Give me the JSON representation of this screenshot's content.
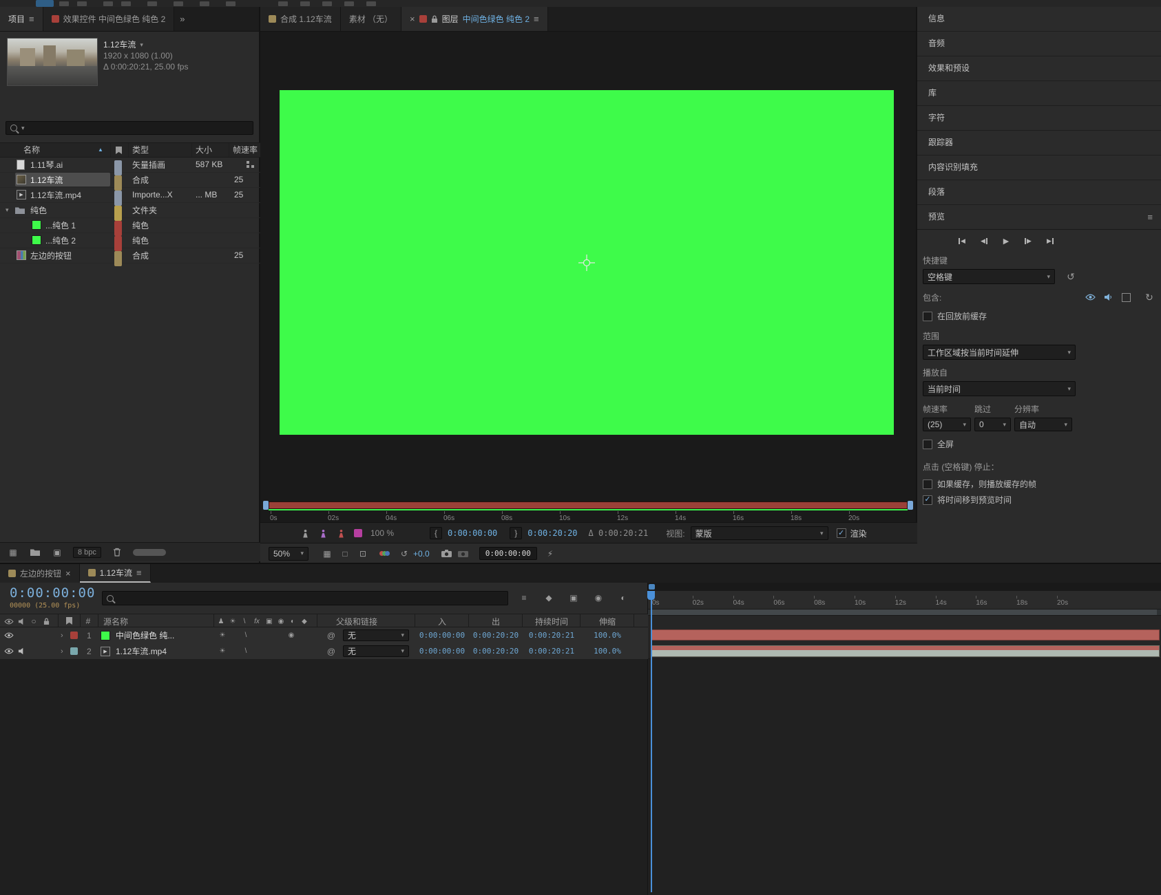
{
  "icons": {
    "menu": "≡",
    "overflow": "»",
    "close": "×",
    "caret": "▾",
    "sort": "▲",
    "chevron": "›",
    "bracket_in": "{",
    "bracket_out": "}",
    "check": "✓",
    "reset": "↺",
    "loop": "↻",
    "play": "▶",
    "rew": "◀",
    "pickwhip": "@",
    "solo": "○",
    "motion_blur": "◉",
    "adjustment": "◐",
    "frame_blend": "▣",
    "collapse": "☀",
    "threed": "◆",
    "shy": "♟",
    "quality": "\\",
    "fx": "fx",
    "lightning": "⚡",
    "grid": "▦",
    "square": "□",
    "roi": "⊡"
  },
  "colors": {
    "solid_green": "#3EFB4A",
    "accent_blue": "#6FB2E4",
    "ruler_red": "#9A4038",
    "layer_bar_salmon": "#B5625C",
    "layer_bar_pale": "#AEB9B1",
    "timecode_blue": "#7CB0DC",
    "frames_tan": "#B59358"
  },
  "project": {
    "tab_project": "项目",
    "tab_effects": "效果控件 中间色绿色 纯色 2",
    "comp_name": "1.12车流",
    "comp_res": "1920 x 1080 (1.00)",
    "comp_dur": "Δ 0:00:20:21, 25.00 fps",
    "col_name": "名称",
    "col_type": "类型",
    "col_size": "大小",
    "col_fps": "帧速率",
    "rows": [
      {
        "name": "1.11琴.ai",
        "type": "矢量插画",
        "size": "587 KB",
        "fps": ""
      },
      {
        "name": "1.12车流",
        "type": "合成",
        "size": "",
        "fps": "25"
      },
      {
        "name": "1.12车流.mp4",
        "type": "Importe...X",
        "size": "... MB",
        "fps": "25"
      },
      {
        "name": "纯色",
        "type": "文件夹",
        "size": "",
        "fps": ""
      },
      {
        "name": "...纯色 1",
        "type": "纯色",
        "size": "",
        "fps": ""
      },
      {
        "name": "...纯色 2",
        "type": "纯色",
        "size": "",
        "fps": ""
      },
      {
        "name": "左边的按钮",
        "type": "合成",
        "size": "",
        "fps": "25"
      }
    ],
    "bpc": "8 bpc"
  },
  "viewer": {
    "tab_comp": "合成 1.12车流",
    "tab_footage": "素材 （无）",
    "tab_layer_prefix": "图层",
    "tab_layer_name": "中间色绿色 纯色 2",
    "ticks": [
      "0s",
      "02s",
      "04s",
      "06s",
      "08s",
      "10s",
      "12s",
      "14s",
      "16s",
      "18s",
      "20s"
    ],
    "opacity": "100 %",
    "tc_current": "0:00:00:00",
    "tc_out": "0:00:20:20",
    "tc_delta": "Δ 0:00:20:21",
    "view_label": "视图:",
    "view_value": "蒙版",
    "render": "渲染",
    "zoom": "50%",
    "exposure": "+0.0",
    "footer_tc": "0:00:00:00"
  },
  "right": {
    "panels": [
      "信息",
      "音频",
      "效果和预设",
      "库",
      "字符",
      "跟踪器",
      "内容识别填充",
      "段落"
    ],
    "preview": {
      "title": "预览",
      "shortcut_label": "快捷键",
      "shortcut_value": "空格键",
      "include": "包含:",
      "cache_before": "在回放前缓存",
      "range_label": "范围",
      "range_value": "工作区域按当前时间延伸",
      "play_from_label": "播放自",
      "play_from_value": "当前时间",
      "fps_label": "帧速率",
      "skip_label": "跳过",
      "res_label": "分辨率",
      "fps_value": "(25)",
      "skip_value": "0",
      "res_value": "自动",
      "fullscreen": "全屏",
      "stop_title": "点击 (空格键) 停止：",
      "opt_cached": "如果缓存，则播放缓存的帧",
      "opt_move_time": "将时间移到预览时间"
    }
  },
  "timeline": {
    "tab_left": "左边的按钮",
    "tab_main": "1.12车流",
    "timecode": "0:00:00:00",
    "frames": "00000 (25.00 fps)",
    "col_num": "#",
    "col_source": "源名称",
    "col_parent": "父级和链接",
    "col_in": "入",
    "col_out": "出",
    "col_duration": "持续时间",
    "col_stretch": "伸缩",
    "layers": [
      {
        "num": "1",
        "name": "中间色绿色 纯...",
        "parent": "无",
        "in": "0:00:00:00",
        "out": "0:00:20:20",
        "duration": "0:00:20:21",
        "stretch": "100.0%"
      },
      {
        "num": "2",
        "name": "1.12车流.mp4",
        "parent": "无",
        "in": "0:00:00:00",
        "out": "0:00:20:20",
        "duration": "0:00:20:21",
        "stretch": "100.0%"
      }
    ],
    "ticks": [
      "0s",
      "02s",
      "04s",
      "06s",
      "08s",
      "10s",
      "12s",
      "14s",
      "16s",
      "18s",
      "20s"
    ]
  }
}
